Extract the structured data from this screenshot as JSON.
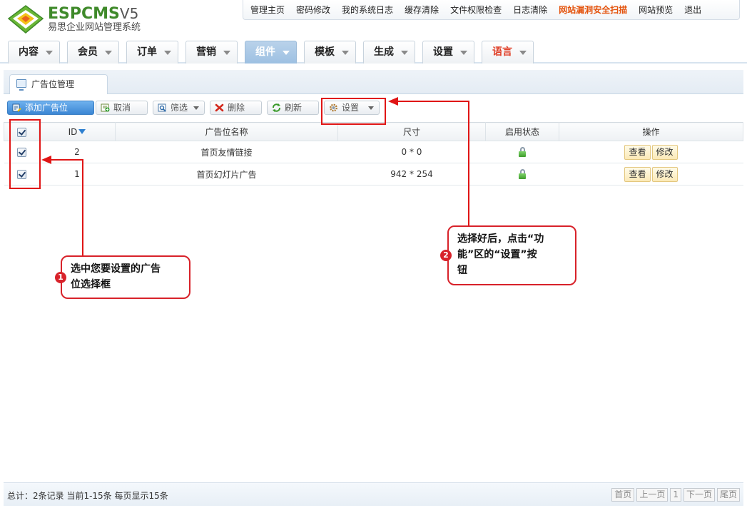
{
  "logo": {
    "title_main": "ESPCMS",
    "title_version": "V5",
    "subtitle": "易思企业网站管理系统"
  },
  "colors": {
    "accent": "#3b86d4",
    "brand": "#3f8a2a",
    "alert": "#e4540e",
    "annotation": "#d8222a"
  },
  "top_nav": [
    "管理主页",
    "密码修改",
    "我的系统日志",
    "缓存清除",
    "文件权限检查",
    "日志清除",
    "网站漏洞安全扫描",
    "网站预览",
    "退出"
  ],
  "main_nav": [
    "内容",
    "会员",
    "订单",
    "营销",
    "组件",
    "模板",
    "生成",
    "设置",
    "语言"
  ],
  "panel": {
    "tab_label": "广告位管理"
  },
  "toolbar": {
    "add": "添加广告位",
    "cancel": "取消",
    "filter": "筛选",
    "delete": "删除",
    "refresh": "刷新",
    "settings": "设置"
  },
  "table": {
    "headers": {
      "id": "ID",
      "name": "广告位名称",
      "size": "尺寸",
      "status": "启用状态",
      "actions": "操作"
    },
    "rows": [
      {
        "id": "2",
        "name": "首页友情链接",
        "size": "0 * 0"
      },
      {
        "id": "1",
        "name": "首页幻灯片广告",
        "size": "942 * 254"
      }
    ],
    "view_label": "查看",
    "edit_label": "修改"
  },
  "footer": {
    "summary": "总计：2条记录 当前1-15条 每页显示15条",
    "pager": {
      "first": "首页",
      "prev": "上一页",
      "current": "1",
      "next": "下一页",
      "last": "尾页"
    }
  },
  "annotations": {
    "step1_number": "1",
    "step1_line1": "选中您要设置的广告",
    "step1_line2": "位选择框",
    "step2_number": "2",
    "step2_line1": "选择好后，点击“功",
    "step2_line2": "能”区的“设置”按",
    "step2_line3": "钮"
  }
}
